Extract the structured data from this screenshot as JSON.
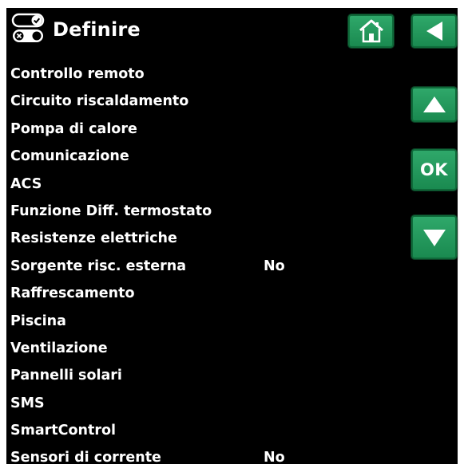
{
  "header": {
    "title": "Definire",
    "settings_icon": "toggle-switches-icon",
    "home_icon": "home-icon",
    "back_icon": "back-arrow-icon"
  },
  "nav": {
    "up_icon": "arrow-up-icon",
    "ok_label": "OK",
    "down_icon": "arrow-down-icon"
  },
  "colors": {
    "background": "#000000",
    "text": "#ffffff",
    "button": "#1f9a5a"
  },
  "menu": [
    {
      "label": "Controllo remoto",
      "value": ""
    },
    {
      "label": "Circuito riscaldamento",
      "value": ""
    },
    {
      "label": "Pompa di calore",
      "value": ""
    },
    {
      "label": "Comunicazione",
      "value": ""
    },
    {
      "label": "ACS",
      "value": ""
    },
    {
      "label": "Funzione Diff. termostato",
      "value": ""
    },
    {
      "label": "Resistenze elettriche",
      "value": ""
    },
    {
      "label": "Sorgente risc. esterna",
      "value": "No"
    },
    {
      "label": "Raffrescamento",
      "value": ""
    },
    {
      "label": "Piscina",
      "value": ""
    },
    {
      "label": "Ventilazione",
      "value": ""
    },
    {
      "label": "Pannelli solari",
      "value": ""
    },
    {
      "label": "SMS",
      "value": ""
    },
    {
      "label": "SmartControl",
      "value": ""
    },
    {
      "label": "Sensori di corrente",
      "value": "No"
    }
  ]
}
